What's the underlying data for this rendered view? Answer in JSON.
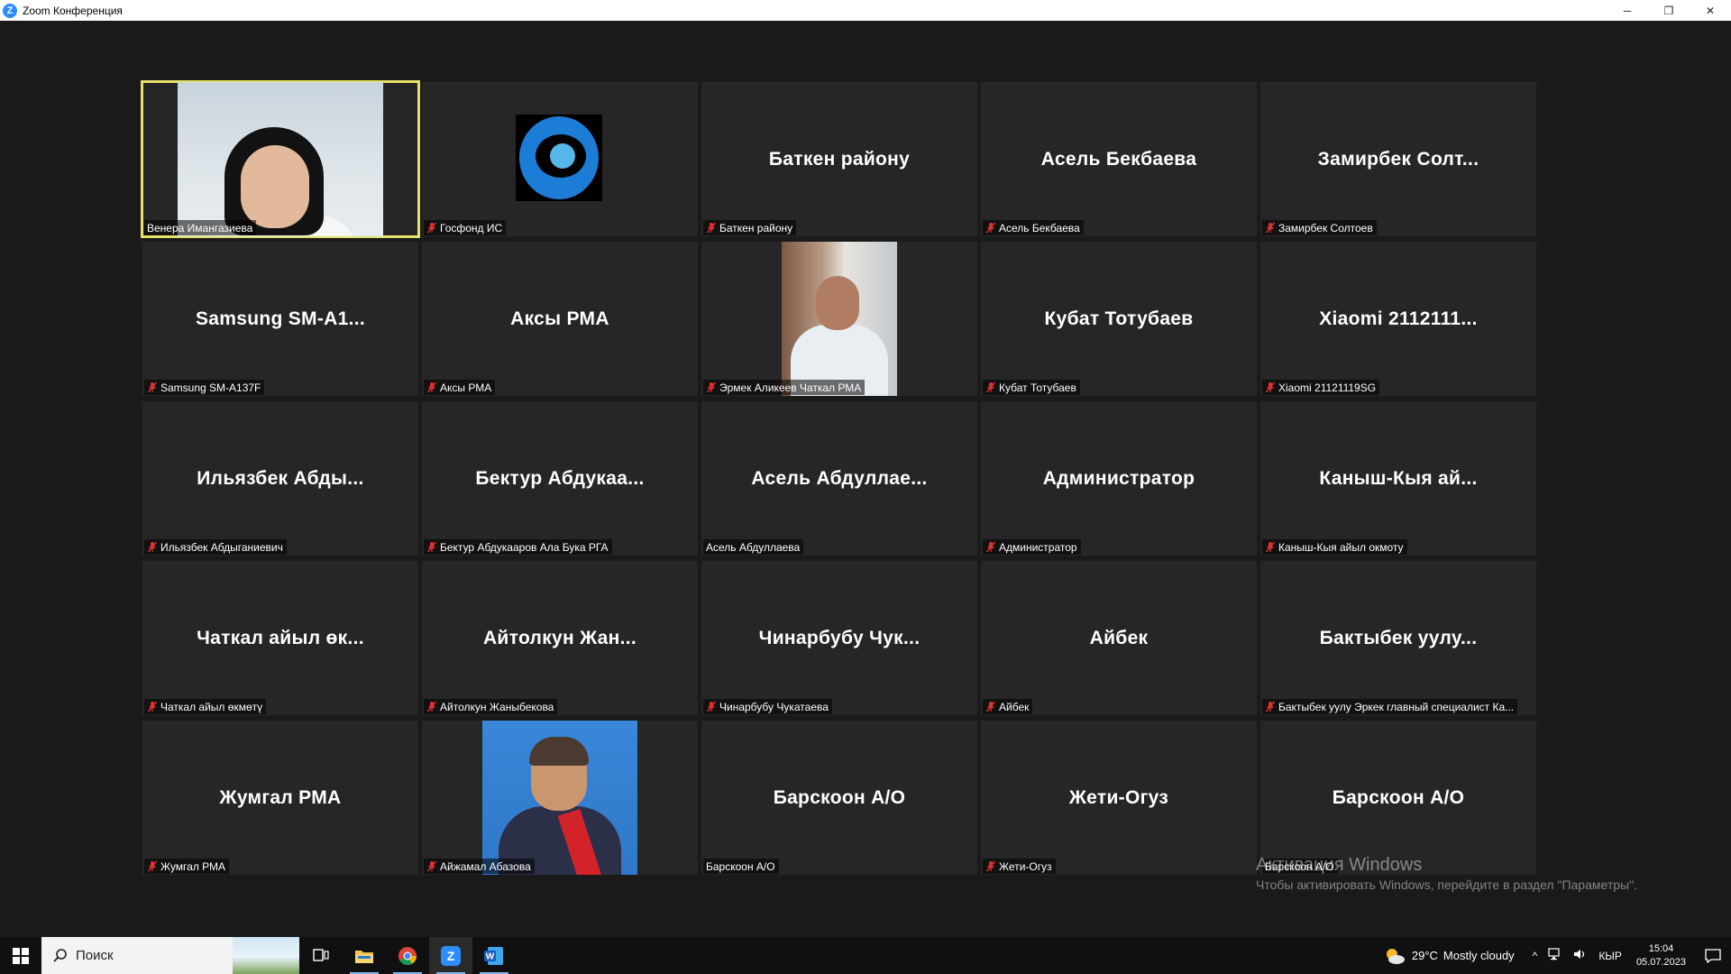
{
  "window": {
    "title": "Zoom Конференция",
    "app_icon_letter": "Z",
    "minimize": "─",
    "restore": "❐",
    "close": "✕"
  },
  "tiles": [
    {
      "big": "",
      "label": "Венера Имангазиева",
      "muted": false,
      "active": true,
      "media": "video-woman"
    },
    {
      "big": "",
      "label": "Госфонд ИС",
      "muted": true,
      "media": "logo"
    },
    {
      "big": "Баткен району",
      "label": "Баткен району",
      "muted": true
    },
    {
      "big": "Асель Бекбаева",
      "label": "Асель Бекбаева",
      "muted": true
    },
    {
      "big": "Замирбек Солт...",
      "label": "Замирбек Солтоев",
      "muted": true
    },
    {
      "big": "Samsung SM-A1...",
      "label": "Samsung SM-A137F",
      "muted": true
    },
    {
      "big": "Аксы РМА",
      "label": "Аксы РМА",
      "muted": true
    },
    {
      "big": "",
      "label": "Эрмек Аликеев Чаткал РМА",
      "muted": true,
      "media": "video-man"
    },
    {
      "big": "Кубат Тотубаев",
      "label": "Кубат Тотубаев",
      "muted": true
    },
    {
      "big": "Xiaomi 2112111...",
      "label": "Xiaomi 21121119SG",
      "muted": true
    },
    {
      "big": "Ильязбек Абды...",
      "label": "Ильязбек Абдыганиевич",
      "muted": true
    },
    {
      "big": "Бектур Абдукаа...",
      "label": "Бектур Абдукааров Ала Бука РГА",
      "muted": true
    },
    {
      "big": "Асель Абдуллае...",
      "label": "Асель Абдуллаева",
      "muted": false
    },
    {
      "big": "Администратор",
      "label": "Администратор",
      "muted": true
    },
    {
      "big": "Каныш-Кыя ай...",
      "label": "Каныш-Кыя айыл окмоту",
      "muted": true
    },
    {
      "big": "Чаткал айыл өк...",
      "label": "Чаткал айыл өкмөтү",
      "muted": true
    },
    {
      "big": "Айтолкун Жан...",
      "label": "Айтолкун Жаныбекова",
      "muted": true
    },
    {
      "big": "Чинарбубу Чук...",
      "label": "Чинарбубу Чукатаева",
      "muted": true
    },
    {
      "big": "Айбек",
      "label": "Айбек",
      "muted": true
    },
    {
      "big": "Бактыбек уулу...",
      "label": "Бактыбек уулу Эркек главный специалист Ка...",
      "muted": true
    },
    {
      "big": "Жумгал РМА",
      "label": "Жумгал РМА",
      "muted": true
    },
    {
      "big": "",
      "label": "Айжамал Абазова",
      "muted": true,
      "media": "video-elder"
    },
    {
      "big": "Барскоон А/О",
      "label": "Барскоон А/О",
      "muted": false
    },
    {
      "big": "Жети-Огуз",
      "label": "Жети-Огуз",
      "muted": true
    },
    {
      "big": "Барскоон А/О",
      "label": "Барскоон А/О",
      "muted": false
    }
  ],
  "watermark": {
    "line1": "Активация Windows",
    "line2": "Чтобы активировать Windows, перейдите в раздел \"Параметры\"."
  },
  "taskbar": {
    "search_placeholder": "Поиск",
    "weather_temp": "29°C",
    "weather_desc": "Mostly cloudy",
    "language": "КЫР",
    "time": "15:04",
    "date": "05.07.2023",
    "apps": [
      "task-view-icon",
      "file-explorer-icon",
      "chrome-icon",
      "zoom-icon",
      "word-icon"
    ]
  },
  "colors": {
    "active_speaker": "#e3e36b",
    "mute_red": "#e0312f",
    "tile_bg": "#262626",
    "zoom_blue": "#2d8cff"
  }
}
